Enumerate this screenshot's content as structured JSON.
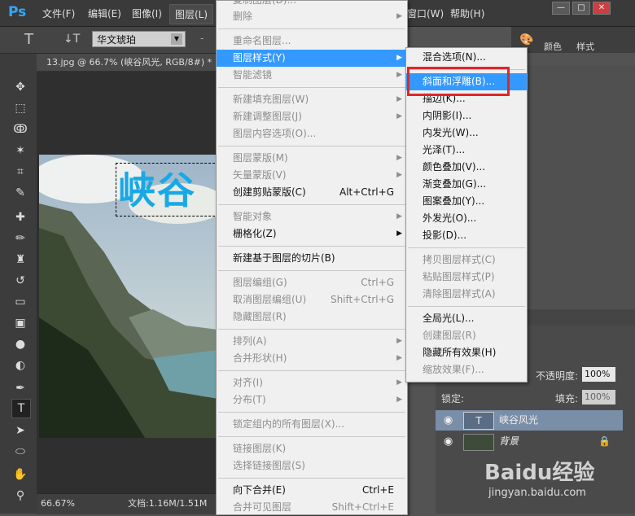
{
  "menubar": {
    "logo": "Ps",
    "items": [
      "文件(F)",
      "编辑(E)",
      "图像(I)",
      "图层(L)"
    ],
    "right_items": [
      "窗口(W)",
      "帮助(H)"
    ]
  },
  "options": {
    "text_tool_glyph": "T",
    "vertical_text_glyph": "↓T",
    "font_family": "华文琥珀",
    "font_size_hint": "-"
  },
  "document": {
    "tab_title": "13.jpg @ 66.7% (峡谷风光, RGB/8#) *",
    "headline_text": "峡谷",
    "zoom": "66.67%",
    "doc_size": "文档:1.16M/1.51M"
  },
  "layer_menu": {
    "top_cut": "复制图层(D)...",
    "items": [
      {
        "label": "删除",
        "disabled": true,
        "submenu": true
      },
      {
        "sep": true
      },
      {
        "label": "重命名图层...",
        "disabled": true
      },
      {
        "label": "图层样式(Y)",
        "highlight": true,
        "submenu": true
      },
      {
        "label": "智能滤镜",
        "disabled": true,
        "submenu": true
      },
      {
        "sep": true
      },
      {
        "label": "新建填充图层(W)",
        "disabled": true,
        "submenu": true
      },
      {
        "label": "新建调整图层(J)",
        "disabled": true,
        "submenu": true
      },
      {
        "label": "图层内容选项(O)...",
        "disabled": true
      },
      {
        "sep": true
      },
      {
        "label": "图层蒙版(M)",
        "disabled": true,
        "submenu": true
      },
      {
        "label": "矢量蒙版(V)",
        "disabled": true,
        "submenu": true
      },
      {
        "label": "创建剪贴蒙版(C)",
        "shortcut": "Alt+Ctrl+G"
      },
      {
        "sep": true
      },
      {
        "label": "智能对象",
        "disabled": true,
        "submenu": true
      },
      {
        "label": "栅格化(Z)",
        "submenu": true
      },
      {
        "sep": true
      },
      {
        "label": "新建基于图层的切片(B)"
      },
      {
        "sep": true
      },
      {
        "label": "图层编组(G)",
        "disabled": true,
        "shortcut": "Ctrl+G"
      },
      {
        "label": "取消图层编组(U)",
        "disabled": true,
        "shortcut": "Shift+Ctrl+G"
      },
      {
        "label": "隐藏图层(R)",
        "disabled": true
      },
      {
        "sep": true
      },
      {
        "label": "排列(A)",
        "disabled": true,
        "submenu": true
      },
      {
        "label": "合并形状(H)",
        "disabled": true,
        "submenu": true
      },
      {
        "sep": true
      },
      {
        "label": "对齐(I)",
        "disabled": true,
        "submenu": true
      },
      {
        "label": "分布(T)",
        "disabled": true,
        "submenu": true
      },
      {
        "sep": true
      },
      {
        "label": "锁定组内的所有图层(X)...",
        "disabled": true
      },
      {
        "sep": true
      },
      {
        "label": "链接图层(K)",
        "disabled": true
      },
      {
        "label": "选择链接图层(S)",
        "disabled": true
      },
      {
        "sep": true
      },
      {
        "label": "向下合并(E)",
        "shortcut": "Ctrl+E"
      },
      {
        "label": "合并可见图层",
        "disabled": true,
        "shortcut": "Shift+Ctrl+E"
      }
    ]
  },
  "style_menu": {
    "items": [
      {
        "label": "混合选项(N)..."
      },
      {
        "sep": true
      },
      {
        "label": "斜面和浮雕(B)...",
        "highlight": true
      },
      {
        "label": "描边(K)..."
      },
      {
        "label": "内阴影(I)..."
      },
      {
        "label": "内发光(W)..."
      },
      {
        "label": "光泽(T)..."
      },
      {
        "label": "颜色叠加(V)..."
      },
      {
        "label": "渐变叠加(G)..."
      },
      {
        "label": "图案叠加(Y)..."
      },
      {
        "label": "外发光(O)..."
      },
      {
        "label": "投影(D)..."
      },
      {
        "sep": true
      },
      {
        "label": "拷贝图层样式(C)",
        "disabled": true
      },
      {
        "label": "粘贴图层样式(P)",
        "disabled": true
      },
      {
        "label": "清除图层样式(A)",
        "disabled": true
      },
      {
        "sep": true
      },
      {
        "label": "全局光(L)..."
      },
      {
        "label": "创建图层(R)",
        "disabled": true
      },
      {
        "label": "隐藏所有效果(H)"
      },
      {
        "label": "缩放效果(F)...",
        "disabled": true
      }
    ]
  },
  "panels": {
    "color_label": "颜色",
    "style_label": "样式",
    "opacity_label": "不透明度:",
    "opacity_value": "100%",
    "lock_label": "锁定:",
    "fill_label": "填充:",
    "fill_value": "100%",
    "layers": [
      {
        "name": "峡谷风光",
        "kind": "T",
        "selected": true
      },
      {
        "name": "背景",
        "kind": "image",
        "locked": true
      }
    ]
  },
  "watermark": {
    "logo": "Baidu经验",
    "url": "jingyan.baidu.com"
  },
  "colors": {
    "highlight": "#3399ff",
    "callout": "#e0262a",
    "headline": "#19a8e6"
  }
}
